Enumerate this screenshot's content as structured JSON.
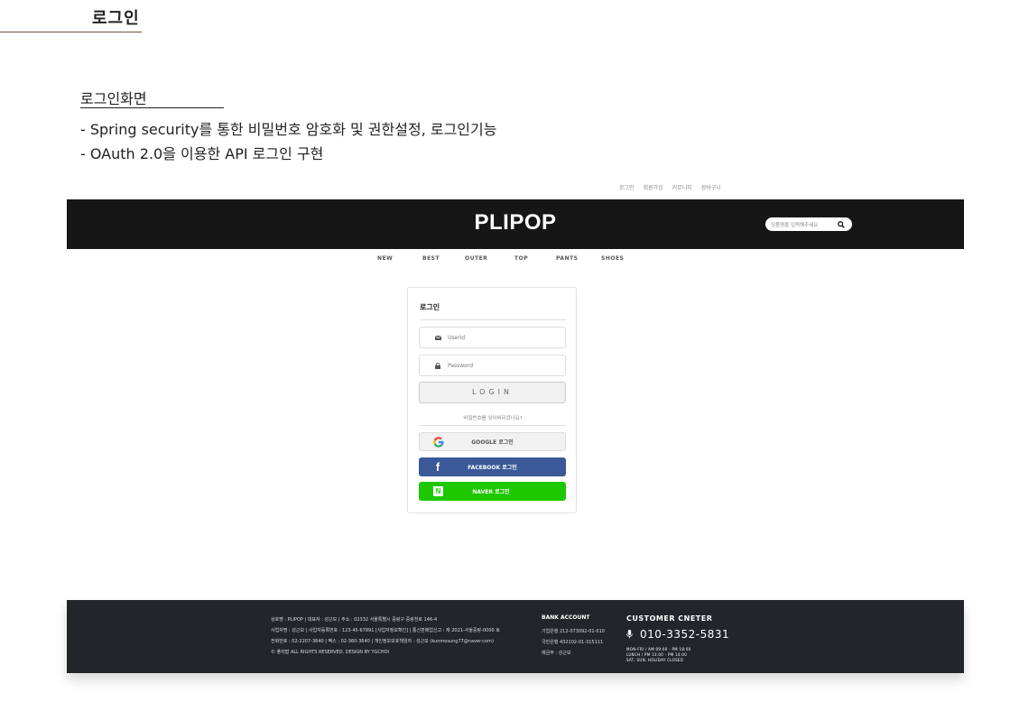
{
  "page": {
    "title": "로그인",
    "section_title": "로그인화면",
    "descriptions": [
      "- Spring security를 통한 비밀번호 암호화 및 권한설정, 로그인기능",
      "- OAuth 2.0을 이용한 API 로그인 구현"
    ]
  },
  "util_links": [
    "로그인",
    "회원가입",
    "커뮤니티",
    "장바구니"
  ],
  "header": {
    "logo": "PLIPOP",
    "search_placeholder": "상품명을 입력해주세요"
  },
  "nav": [
    "NEW",
    "BEST",
    "OUTER",
    "TOP",
    "PANTS",
    "SHOES"
  ],
  "login": {
    "heading": "로그인",
    "userid_placeholder": "Userid",
    "password_placeholder": "Password",
    "login_button": "LOGIN",
    "forgot_link": "비밀번호를 잊어버리셨나요?",
    "google_label": "GOOGLE 로그인",
    "facebook_label": "FACEBOOK 로그인",
    "naver_label": "NAVER 로그인",
    "naver_icon_letter": "N",
    "facebook_icon_letter": "f"
  },
  "footer": {
    "lines": [
      "상호명 : PLIPOP | 대표자 : 성근모 | 주소 : 02332 서울특별시 중랑구 중랑천로 146-4",
      "사업자명 : 성근모 | 사업자등록번호 : 123-45-67891 [사업자정보확인] | 통신판매업신고 : 제 2021-서울중랑-0000 호",
      "전화번호 : 02-2207-3640 | 팩스 : 02-360-3640 | 개인정보보호책임자 : 성근모 (kunmosung77@naver.com)",
      "© 플리팝 ALL RIGHTS RESERVED. DESIGN BY YGCHOI"
    ],
    "bank_title": "BANK ACCOUNT",
    "bank_lines": [
      "기업은행 212-073092-01-010",
      "국민은행 432102-01-315111",
      "예금주 : 성근모"
    ],
    "cs_title": "CUSTOMER CNETER",
    "cs_phone": "010-3352-5831",
    "hours": [
      "MON-FRI / AM 09:00 - PM 18:00",
      "LUNCH / PM 13:00 - PM 14:00",
      "SAT, SUN, HOLIDAY CLOSED"
    ]
  },
  "colors": {
    "header_bg": "#161616",
    "footer_bg": "#22262a",
    "facebook": "#3b5998",
    "naver": "#1ec800"
  }
}
